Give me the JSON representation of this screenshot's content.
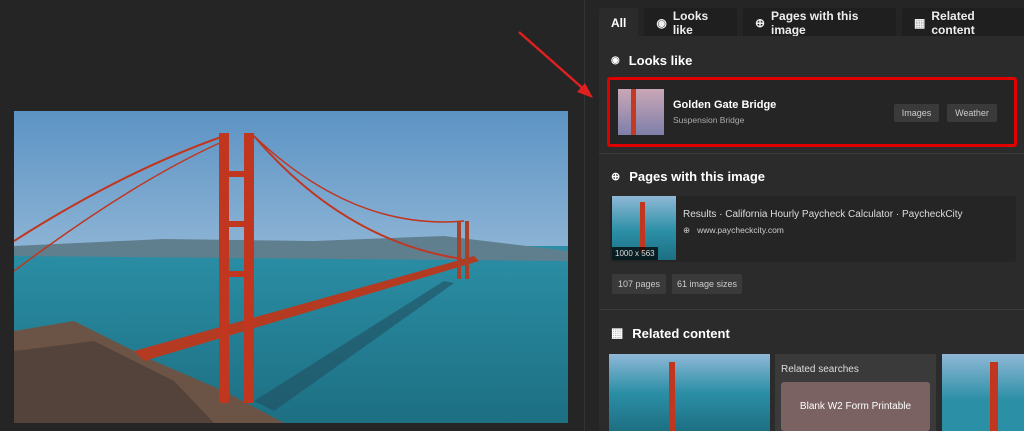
{
  "tabs": [
    {
      "label": "All"
    },
    {
      "label": "Looks like"
    },
    {
      "label": "Pages with this image"
    },
    {
      "label": "Related content"
    }
  ],
  "looks_like": {
    "title": "Looks like",
    "entity_name": "Golden Gate Bridge",
    "entity_type": "Suspension Bridge",
    "buttons": [
      "Images",
      "Weather"
    ]
  },
  "pages": {
    "title": "Pages with this image",
    "result_title": "Results · California Hourly Paycheck Calculator · PaycheckCity",
    "result_url": "www.paycheckcity.com",
    "thumb_size": "1000 x 563",
    "chips": [
      "107 pages",
      "61 image sizes"
    ]
  },
  "related": {
    "title": "Related content",
    "searches_label": "Related searches",
    "search_item": "Blank W2 Form Printable"
  },
  "colors": {
    "highlight": "#e00000",
    "arrow": "#e02020"
  }
}
